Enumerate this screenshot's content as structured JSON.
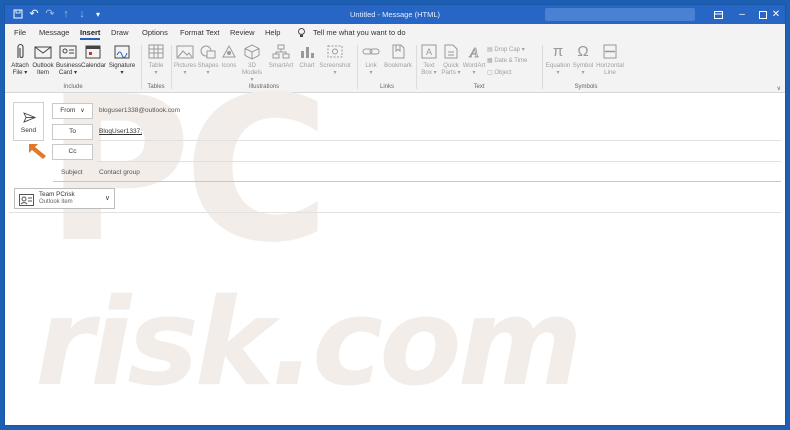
{
  "titlebar": {
    "title": "Untitled  -  Message (HTML)",
    "icons": [
      "save-icon",
      "undo-icon",
      "redo-icon",
      "up-icon",
      "down-icon",
      "customize-icon"
    ],
    "window_controls": [
      "ribbon-display-icon",
      "minimize-icon",
      "maximize-icon",
      "close-icon"
    ],
    "accent": "#2766c5"
  },
  "menu": {
    "items": [
      "File",
      "Message",
      "Insert",
      "Draw",
      "Options",
      "Format Text",
      "Review",
      "Help"
    ],
    "active": "Insert",
    "tell_me": "Tell me what you want to do"
  },
  "ribbon": {
    "include": {
      "label": "Include",
      "buttons": [
        {
          "line1": "Attach",
          "line2": "File ▾"
        },
        {
          "line1": "Outlook",
          "line2": "Item"
        },
        {
          "line1": "Business",
          "line2": "Card ▾"
        },
        {
          "line1": "Calendar",
          "line2": ""
        },
        {
          "line1": "Signature",
          "line2": "▾"
        }
      ]
    },
    "tables": {
      "label": "Tables",
      "buttons": [
        {
          "line1": "Table",
          "line2": "▾"
        }
      ]
    },
    "illustrations": {
      "label": "Illustrations",
      "buttons": [
        {
          "line1": "Pictures",
          "line2": "▾"
        },
        {
          "line1": "Shapes",
          "line2": "▾"
        },
        {
          "line1": "Icons",
          "line2": ""
        },
        {
          "line1": "3D",
          "line2": "Models ▾"
        },
        {
          "line1": "SmartArt",
          "line2": ""
        },
        {
          "line1": "Chart",
          "line2": ""
        },
        {
          "line1": "Screenshot",
          "line2": "▾"
        }
      ]
    },
    "links": {
      "label": "Links",
      "buttons": [
        {
          "line1": "Link",
          "line2": "▾"
        },
        {
          "line1": "Bookmark",
          "line2": ""
        }
      ]
    },
    "text": {
      "label": "Text",
      "buttons": [
        {
          "line1": "Text",
          "line2": "Box ▾"
        },
        {
          "line1": "Quick",
          "line2": "Parts ▾"
        },
        {
          "line1": "WordArt",
          "line2": "▾"
        }
      ],
      "small": [
        "Drop Cap ▾",
        "Date & Time",
        "Object"
      ]
    },
    "symbols": {
      "label": "Symbols",
      "buttons": [
        {
          "line1": "Equation",
          "line2": "▾"
        },
        {
          "line1": "Symbol",
          "line2": "▾"
        },
        {
          "line1": "Horizontal",
          "line2": "Line"
        }
      ]
    }
  },
  "compose": {
    "send_label": "Send",
    "from_label": "From",
    "from_value": "bloguser1338@outlook.com",
    "to_label": "To",
    "to_value": "BlogUser1337;",
    "cc_label": "Cc",
    "subject_label": "Subject",
    "subject_value": "Contact group",
    "attachment": {
      "name": "Team PCrisk",
      "type": "Outlook item"
    }
  }
}
